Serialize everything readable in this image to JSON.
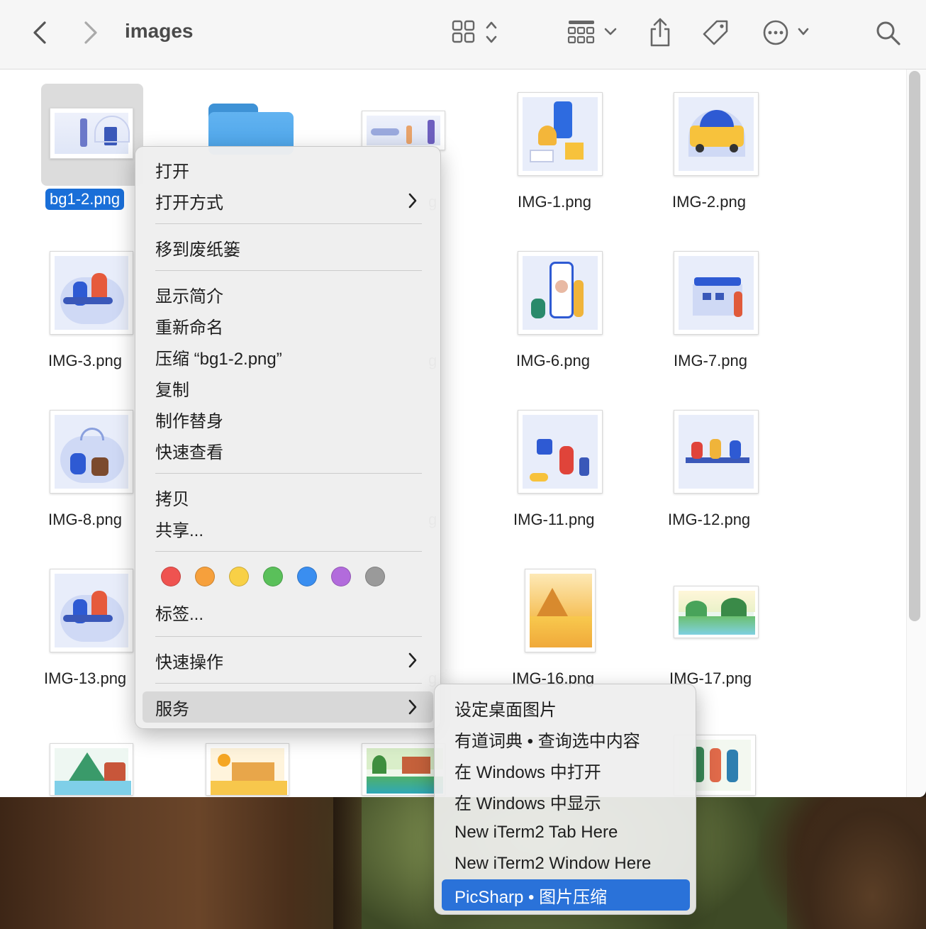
{
  "window": {
    "title": "images",
    "accent": "#1a6fd8"
  },
  "toolbar": {
    "back_icon": "chevron-left-icon",
    "forward_icon": "chevron-right-icon",
    "view_icon": "icon-grid-icon",
    "group_icon": "group-grid-icon",
    "share_icon": "share-icon",
    "tag_icon": "tag-icon",
    "more_icon": "ellipsis-circle-icon",
    "search_icon": "search-icon"
  },
  "files": [
    {
      "name": "bg1-2.png",
      "selected": true
    },
    {
      "name": ""
    },
    {
      "name": "g"
    },
    {
      "name": "IMG-1.png"
    },
    {
      "name": "IMG-2.png"
    },
    {
      "name": "IMG-3.png"
    },
    {
      "name": "g"
    },
    {
      "name": "IMG-6.png"
    },
    {
      "name": "IMG-7.png"
    },
    {
      "name": "IMG-8.png"
    },
    {
      "name": "g"
    },
    {
      "name": "IMG-11.png"
    },
    {
      "name": "IMG-12.png"
    },
    {
      "name": "IMG-13.png"
    },
    {
      "name": "g"
    },
    {
      "name": "IMG-16.png"
    },
    {
      "name": "IMG-17.png"
    }
  ],
  "context_menu": {
    "items": [
      {
        "label": "打开"
      },
      {
        "label": "打开方式",
        "submenu": true
      },
      {
        "label": "移到废纸篓"
      },
      {
        "label": "显示简介"
      },
      {
        "label": "重新命名"
      },
      {
        "label": "压缩 “bg1-2.png”"
      },
      {
        "label": "复制"
      },
      {
        "label": "制作替身"
      },
      {
        "label": "快速查看"
      },
      {
        "label": "拷贝"
      },
      {
        "label": "共享..."
      },
      {
        "label": "标签..."
      },
      {
        "label": "快速操作",
        "submenu": true
      },
      {
        "label": "服务",
        "submenu": true,
        "highlighted": true
      }
    ],
    "tag_colors": [
      "#ef5350",
      "#f6a03c",
      "#f8d046",
      "#5ac05a",
      "#3a8ef0",
      "#b26bdc",
      "#9a9a9a"
    ]
  },
  "services_submenu": {
    "items": [
      {
        "label": "设定桌面图片"
      },
      {
        "label": "有道词典 • 查询选中内容"
      },
      {
        "label": "在 Windows 中打开"
      },
      {
        "label": "在 Windows 中显示"
      },
      {
        "label": "New iTerm2 Tab Here"
      },
      {
        "label": "New iTerm2 Window Here"
      },
      {
        "label": "PicSharp • 图片压缩",
        "active": true
      }
    ],
    "active_color": "#2a72d9"
  }
}
